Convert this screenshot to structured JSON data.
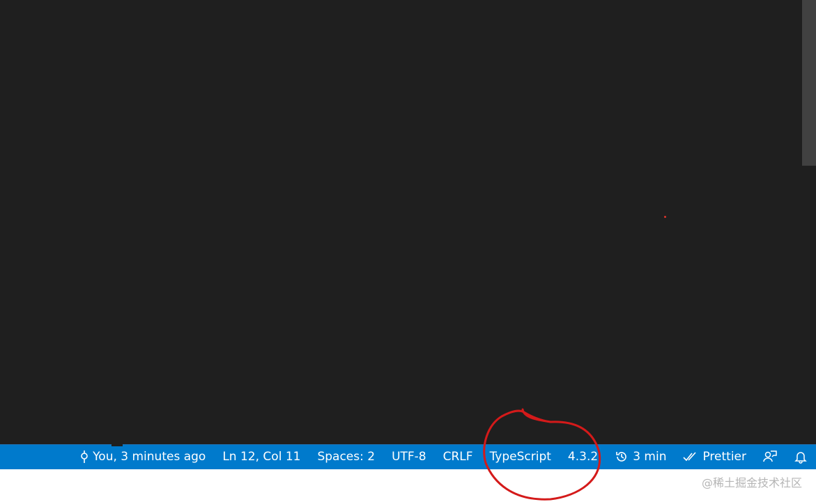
{
  "statusbar": {
    "blame": "You, 3 minutes ago",
    "cursor_position": "Ln 12, Col 11",
    "indentation": "Spaces: 2",
    "encoding": "UTF-8",
    "line_ending": "CRLF",
    "language": "TypeScript",
    "ts_version": "4.3.2",
    "timer": "3 min",
    "formatter": "Prettier",
    "colors": {
      "background": "#007acc",
      "editor": "#1f1f1f"
    }
  },
  "icons": {
    "blame": "git-commit-icon",
    "timer": "history-icon",
    "formatter": "check-all-icon",
    "feedback": "feedback-icon",
    "notifications": "bell-icon"
  },
  "watermark": "@稀土掘金技术社区",
  "annotation_color": "#d41a1a"
}
